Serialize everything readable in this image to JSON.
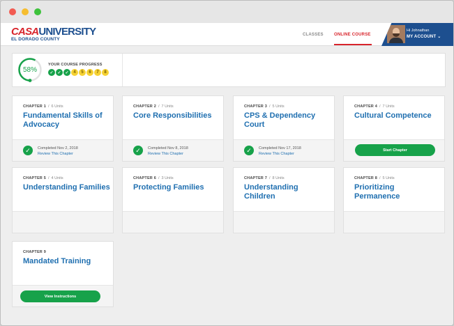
{
  "header": {
    "logo_casa": "CASA",
    "logo_university": "UNIVERSITY",
    "logo_subtitle": "EL DORADO COUNTY",
    "nav": [
      {
        "label": "CLASSES"
      },
      {
        "label": "ONLINE COURSE",
        "active": true
      }
    ],
    "account": {
      "greeting": "Hi Johnathan",
      "label": "MY ACCOUNT",
      "dropdown_icon": "chevron-down-icon"
    }
  },
  "progress": {
    "percent_label": "58%",
    "percent": 58,
    "title": "YOUR COURSE PROGRESS",
    "steps": [
      {
        "label": "✓",
        "state": "done"
      },
      {
        "label": "✓",
        "state": "done"
      },
      {
        "label": "✓",
        "state": "done"
      },
      {
        "label": "4",
        "state": "todo"
      },
      {
        "label": "5",
        "state": "todo"
      },
      {
        "label": "6",
        "state": "todo"
      },
      {
        "label": "7",
        "state": "todo"
      },
      {
        "label": "8",
        "state": "todo"
      }
    ]
  },
  "chapters": [
    {
      "num": "CHAPTER 1",
      "units": "6 Units",
      "title": "Fundamental Skills of Advocacy",
      "completed": "Completed Nov 2, 2018",
      "review": "Review This Chapter"
    },
    {
      "num": "CHAPTER 2",
      "units": "7 Units",
      "title": "Core Responsibilities",
      "completed": "Completed Nov 8, 2018",
      "review": "Review This Chapter"
    },
    {
      "num": "CHAPTER 3",
      "units": "5 Units",
      "title": "CPS & Dependency Court",
      "completed": "Completed Nov 17, 2018",
      "review": "Review This Chapter"
    },
    {
      "num": "CHAPTER 4",
      "units": "7 Units",
      "title": "Cultural Competence",
      "button": "Start Chapter"
    },
    {
      "num": "CHAPTER 5",
      "units": "4 Units",
      "title": "Understanding Families"
    },
    {
      "num": "CHAPTER 6",
      "units": "3 Units",
      "title": "Protecting Families"
    },
    {
      "num": "CHAPTER 7",
      "units": "8 Units",
      "title": "Understanding Children"
    },
    {
      "num": "CHAPTER 8",
      "units": "5 Units",
      "title": "Prioritizing Permanence"
    },
    {
      "num": "CHAPTER 9",
      "title": "Mandated Training",
      "button": "View Instructions"
    }
  ],
  "colors": {
    "brand_blue": "#1d4f8f",
    "brand_red": "#d8242b",
    "success_green": "#17a24a",
    "pending_yellow": "#f6d233",
    "link_blue": "#1f6fb0"
  }
}
